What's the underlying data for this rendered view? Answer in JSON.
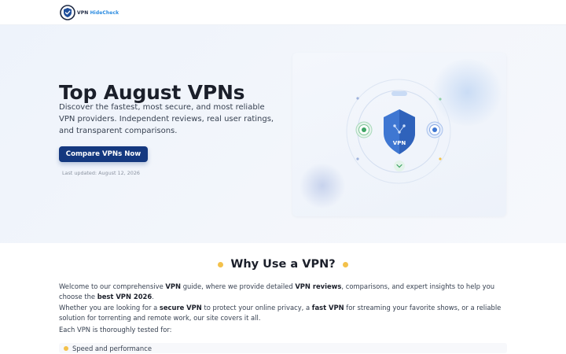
{
  "header": {
    "logo_text_a": "VPN ",
    "logo_text_b": "HideCheck",
    "logo_icon": "shield-check-icon"
  },
  "hero": {
    "title": "Top August VPNs",
    "description": "Discover the fastest, most secure, and most reliable VPN providers. Independent reviews, real user ratings, and transparent comparisons.",
    "cta_label": "Compare VPNs Now",
    "last_updated": "Last updated: August 12, 2026",
    "shield_label": "VPN"
  },
  "section": {
    "title": "Why Use a VPN?",
    "p1": {
      "t1": "Welcome to our comprehensive ",
      "b1": "VPN",
      "t2": " guide, where we provide detailed ",
      "b2": "VPN reviews",
      "t3": ", comparisons, and expert insights to help you choose the ",
      "b3": "best VPN 2026",
      "t4": "."
    },
    "p2": {
      "t1": "Whether you are looking for a ",
      "b1": "secure VPN",
      "t2": " to protect your online privacy, a ",
      "b2": "fast VPN",
      "t3": " for streaming your favorite shows, or a reliable solution for torrenting and remote work, our site covers it all."
    },
    "p3": "Each VPN is thoroughly tested for:",
    "features": [
      "Speed and performance"
    ]
  },
  "colors": {
    "brand_dark": "#14387f",
    "accent_blue": "#2a8be0",
    "bullet_yellow": "#f3c14b",
    "shield_blue": "#3f77d2"
  }
}
